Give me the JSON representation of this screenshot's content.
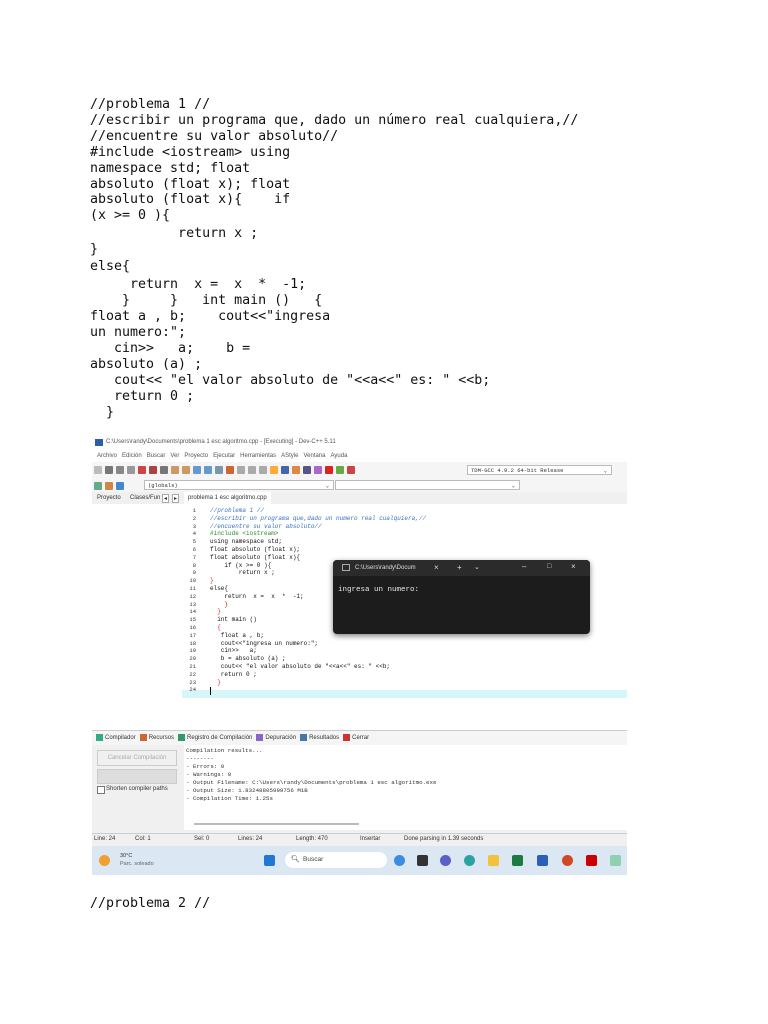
{
  "document": {
    "lines": [
      "//problema 1 //",
      "//escribir un programa que, dado un número real cualquiera,//",
      "//encuentre su valor absoluto//",
      "#include <iostream> using",
      "namespace std; float",
      "absoluto (float x); float",
      "absoluto (float x){    if",
      "(x >= 0 ){",
      "           return x ;",
      "}",
      "else{",
      "     return  x =  x  *  -1;",
      "    }     }   int main ()   {",
      "float a , b;    cout<<\"ingresa",
      "un numero:\";",
      "   cin>>   a;    b =",
      "absoluto (a) ;",
      "   cout<< \"el valor absoluto de \"<<a<<\" es: \" <<b;",
      "   return 0 ;",
      "  }"
    ],
    "footer_line": "//problema 2 //"
  },
  "ide": {
    "title": "C:\\Users\\randy\\Documents\\problema 1 esc algoritmo.cpp - [Executing] - Dev-C++ 5.11",
    "menu": [
      "Archivo",
      "Edición",
      "Buscar",
      "Ver",
      "Proyecto",
      "Ejecutar",
      "Herramientas",
      "AStyle",
      "Ventana",
      "Ayuda"
    ],
    "compiler_select": "TDM-GCC 4.9.2 64-bit Release",
    "scope_select": "(globals)",
    "left_tabs": [
      "Proyecto",
      "Clases/Fun"
    ],
    "file_tab": "problema 1 esc algoritmo.cpp",
    "code_lines": [
      "//problema 1 //",
      "//escribir un programa que,dado un numero real cualquiera,//",
      "//encuentre su valor absoluto//",
      "#include <iostream>",
      "using namespace std;",
      "float absoluto (float x);",
      "float absoluto (float x){",
      "    if (x >= 0 ){",
      "        return x ;",
      "}",
      "else{",
      "    return  x =  x  *  -1;",
      "    }",
      "  }",
      "  int main ()",
      "  {",
      "   float a , b;",
      "   cout<<\"ingresa un numero:\";",
      "   cin>>   a;",
      "   b = absoluto (a) ;",
      "   cout<< \"el valor absoluto de \"<<a<<\" es: \" <<b;",
      "   return 0 ;",
      "  }",
      ""
    ],
    "terminal": {
      "tab_title": "C:\\Users\\randy\\Docum",
      "output": "ingresa un numero:"
    },
    "bottom_tabs": [
      "Compilador",
      "Recursos",
      "Registro de Compilación",
      "Depuración",
      "Resultados",
      "Cerrar"
    ],
    "cancel_button": "Cancelar Compilación",
    "shorten_label": "Shorten compiler paths",
    "compile_log": [
      "Compilation results...",
      "--------",
      "- Errors: 0",
      "- Warnings: 0",
      "- Output Filename: C:\\Users\\randy\\Documents\\problema 1 esc algoritmo.exe",
      "- Output Size: 1.83248805999756 MiB",
      "- Compilation Time: 1.25s"
    ],
    "status": {
      "line": "Line:  24",
      "col": "Col:  1",
      "sel": "Sel:  0",
      "lines": "Lines:  24",
      "length": "Length:  470",
      "mode": "Insertar",
      "parse": "Done parsing in 1.39 seconds"
    },
    "taskbar": {
      "temp": "30°C",
      "weather": "Parc. soleado",
      "search": "Buscar"
    }
  }
}
